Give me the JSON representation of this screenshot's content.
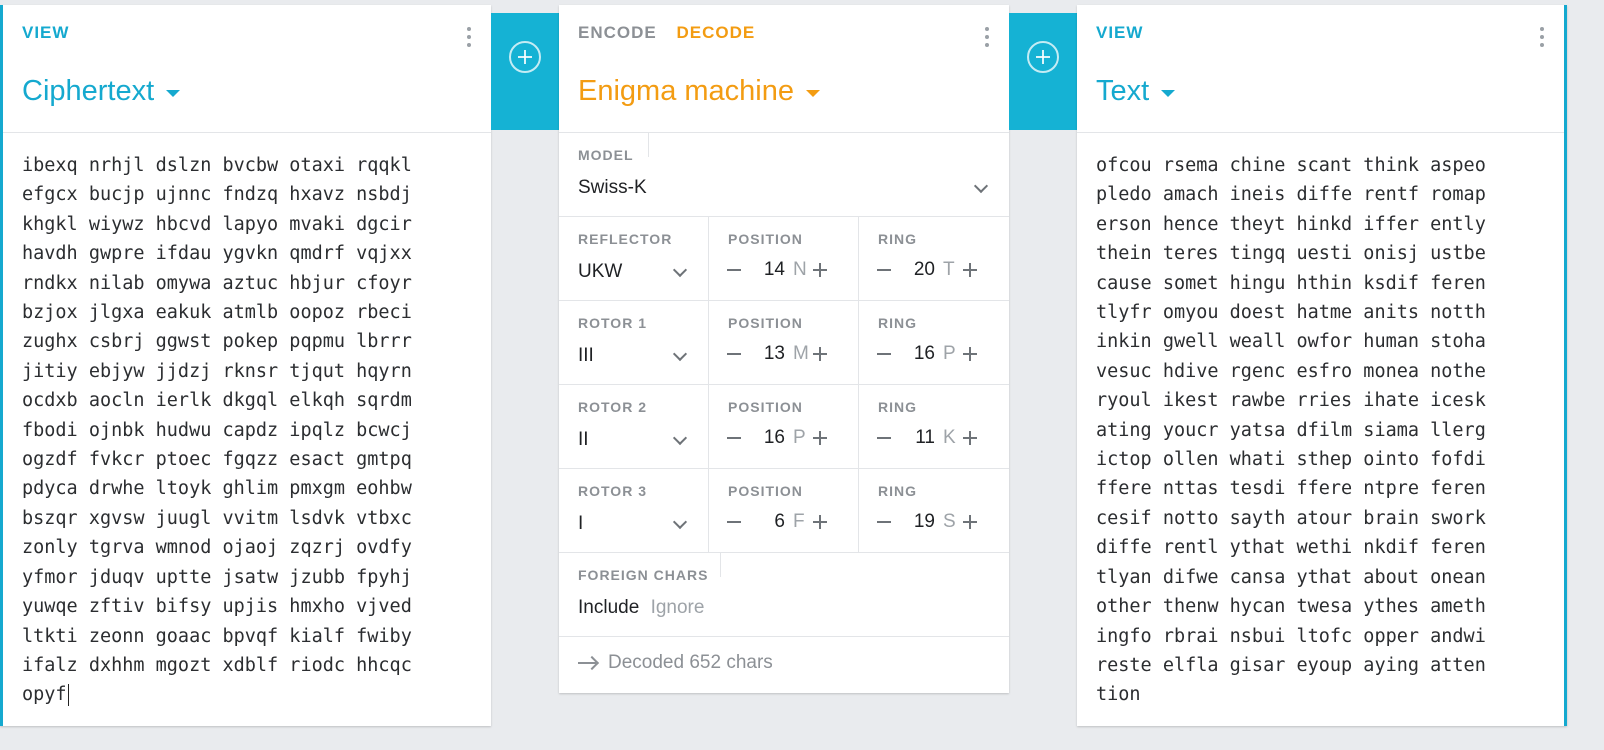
{
  "left_panel": {
    "tab": "VIEW",
    "title": "Ciphertext",
    "text": "ibexq nrhjl dslzn bvcbw otaxi rqqkl\nefgcx bucjp ujnnc fndzq hxavz nsbdj\nkhgkl wiywz hbcvd lapyo mvaki dgcir\nhavdh gwpre ifdau ygvkn qmdrf vqjxx\nrndkx nilab omywa aztuc hbjur cfoyr\nbzjox jlgxa eakuk atmlb oopoz rbeci\nzughx csbrj ggwst pokep pqpmu lbrrr\njitiy ebjyw jjdzj rknsr tjqut hqyrn\nocdxb aocln ierlk dkgql elkqh sqrdm\nfbodi ojnbk hudwu capdz ipqlz bcwcj\nogzdf fvkcr ptoec fgqzz esact gmtpq\npdyca drwhe ltoyk ghlim pmxgm eohbw\nbszqr xgvsw juugl vvitm lsdvk vtbxc\nzonly tgrva wmnod ojaoj zqzrj ovdfy\nyfmor jduqv uptte jsatw jzubb fpyhj\nyuwqe zftiv bifsy upjis hmxho vjved\nltkti zeonn goaac bpvqf kialf fwiby\nifalz dxhhm mgozt xdblf riodc hhcqc\nopyf"
  },
  "middle_panel": {
    "tab_encode": "ENCODE",
    "tab_decode": "DECODE",
    "title": "Enigma machine",
    "model": {
      "label": "MODEL",
      "value": "Swiss-K"
    },
    "rows": [
      {
        "name": "reflector",
        "label": "REFLECTOR",
        "value": "UKW",
        "position_label": "POSITION",
        "position": "14",
        "position_letter": "N",
        "ring_label": "RING",
        "ring": "20",
        "ring_letter": "T"
      },
      {
        "name": "rotor-1",
        "label": "ROTOR 1",
        "value": "III",
        "position_label": "POSITION",
        "position": "13",
        "position_letter": "M",
        "ring_label": "RING",
        "ring": "16",
        "ring_letter": "P"
      },
      {
        "name": "rotor-2",
        "label": "ROTOR 2",
        "value": "II",
        "position_label": "POSITION",
        "position": "16",
        "position_letter": "P",
        "ring_label": "RING",
        "ring": "11",
        "ring_letter": "K"
      },
      {
        "name": "rotor-3",
        "label": "ROTOR 3",
        "value": "I",
        "position_label": "POSITION",
        "position": "6",
        "position_letter": "F",
        "ring_label": "RING",
        "ring": "19",
        "ring_letter": "S"
      }
    ],
    "foreign_chars": {
      "label": "FOREIGN CHARS",
      "include": "Include",
      "ignore": "Ignore"
    },
    "status": "Decoded 652 chars"
  },
  "right_panel": {
    "tab": "VIEW",
    "title": "Text",
    "text": "ofcou rsema chine scant think aspeo\npledo amach ineis diffe rentf romap\nerson hence theyt hinkd iffer ently\nthein teres tingq uesti onisj ustbe\ncause somet hingu hthin ksdif feren\ntlyfr omyou doest hatme anits notth\ninkin gwell weall owfor human stoha\nvesuc hdive rgenc esfro monea nothe\nryoul ikest rawbe rries ihate icesk\nating youcr yatsa dfilm siama llerg\nictop ollen whati sthep ointo fofdi\nffere nttas tesdi ffere ntpre feren\ncesif notto sayth atour brain swork\ndiffe rentl ythat wethi nkdif feren\ntlyan difwe cansa ythat about onean\nother thenw hycan twesa ythes ameth\ningfo rbrai nsbui ltofc opper andwi\nreste elfla gisar eyoup aying atten\ntion"
  },
  "colors": {
    "accent_blue": "#15a9cf",
    "accent_orange": "#f39c12"
  },
  "icons": [
    "more-vert-icon",
    "add-circle-icon",
    "chevron-down-icon",
    "minus-icon",
    "plus-icon",
    "arrow-right-icon"
  ]
}
